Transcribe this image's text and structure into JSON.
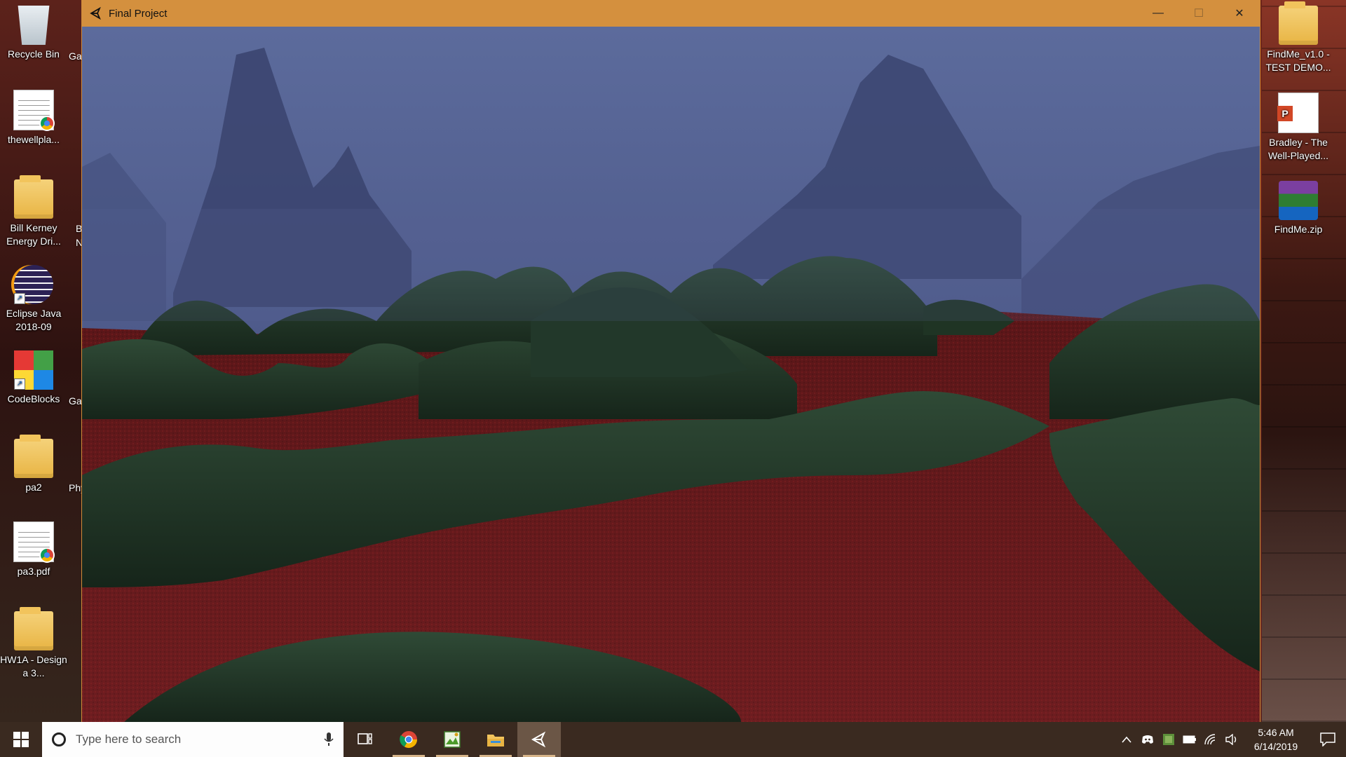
{
  "window": {
    "title": "Final Project",
    "controls": {
      "minimize": "—",
      "maximize": "☐",
      "close": "✕"
    }
  },
  "desktop": {
    "left_icons": [
      {
        "label": "Recycle Bin",
        "icon": "recycle-bin-icon"
      },
      {
        "label": "thewellpla...",
        "icon": "chrome-document-icon"
      },
      {
        "label": "Bill Kerney Energy Dri...",
        "icon": "folder-icon"
      },
      {
        "label": "Eclipse Java 2018-09",
        "icon": "eclipse-icon"
      },
      {
        "label": "CodeBlocks",
        "icon": "codeblocks-icon"
      },
      {
        "label": "pa2",
        "icon": "folder-icon"
      },
      {
        "label": "pa3.pdf",
        "icon": "pdf-document-icon"
      },
      {
        "label": "HW1A - Design a 3...",
        "icon": "folder-icon"
      }
    ],
    "partial_labels": [
      "Ga",
      "B",
      "N",
      "Ga",
      "Phy"
    ],
    "right_icons": [
      {
        "label": "FindMe_v1.0 - TEST DEMO...",
        "icon": "folder-icon"
      },
      {
        "label": "Bradley - The Well-Played...",
        "icon": "powerpoint-icon"
      },
      {
        "label": "FindMe.zip",
        "icon": "winrar-archive-icon"
      }
    ]
  },
  "taskbar": {
    "search_placeholder": "Type here to search",
    "apps": [
      {
        "name": "task-view",
        "icon": "task-view-icon"
      },
      {
        "name": "chrome",
        "icon": "chrome-icon"
      },
      {
        "name": "image-editor",
        "icon": "image-editor-icon"
      },
      {
        "name": "file-explorer",
        "icon": "folder-icon"
      },
      {
        "name": "unity",
        "icon": "unity-icon"
      }
    ],
    "clock": {
      "time": "5:46 AM",
      "date": "6/14/2019"
    }
  },
  "colors": {
    "titlebar": "#d4903e",
    "taskbar": "#3a2a20",
    "sky": "#5f6d9c",
    "terrain_green": "#1f3424",
    "terrain_red": "#6a1a1c"
  }
}
